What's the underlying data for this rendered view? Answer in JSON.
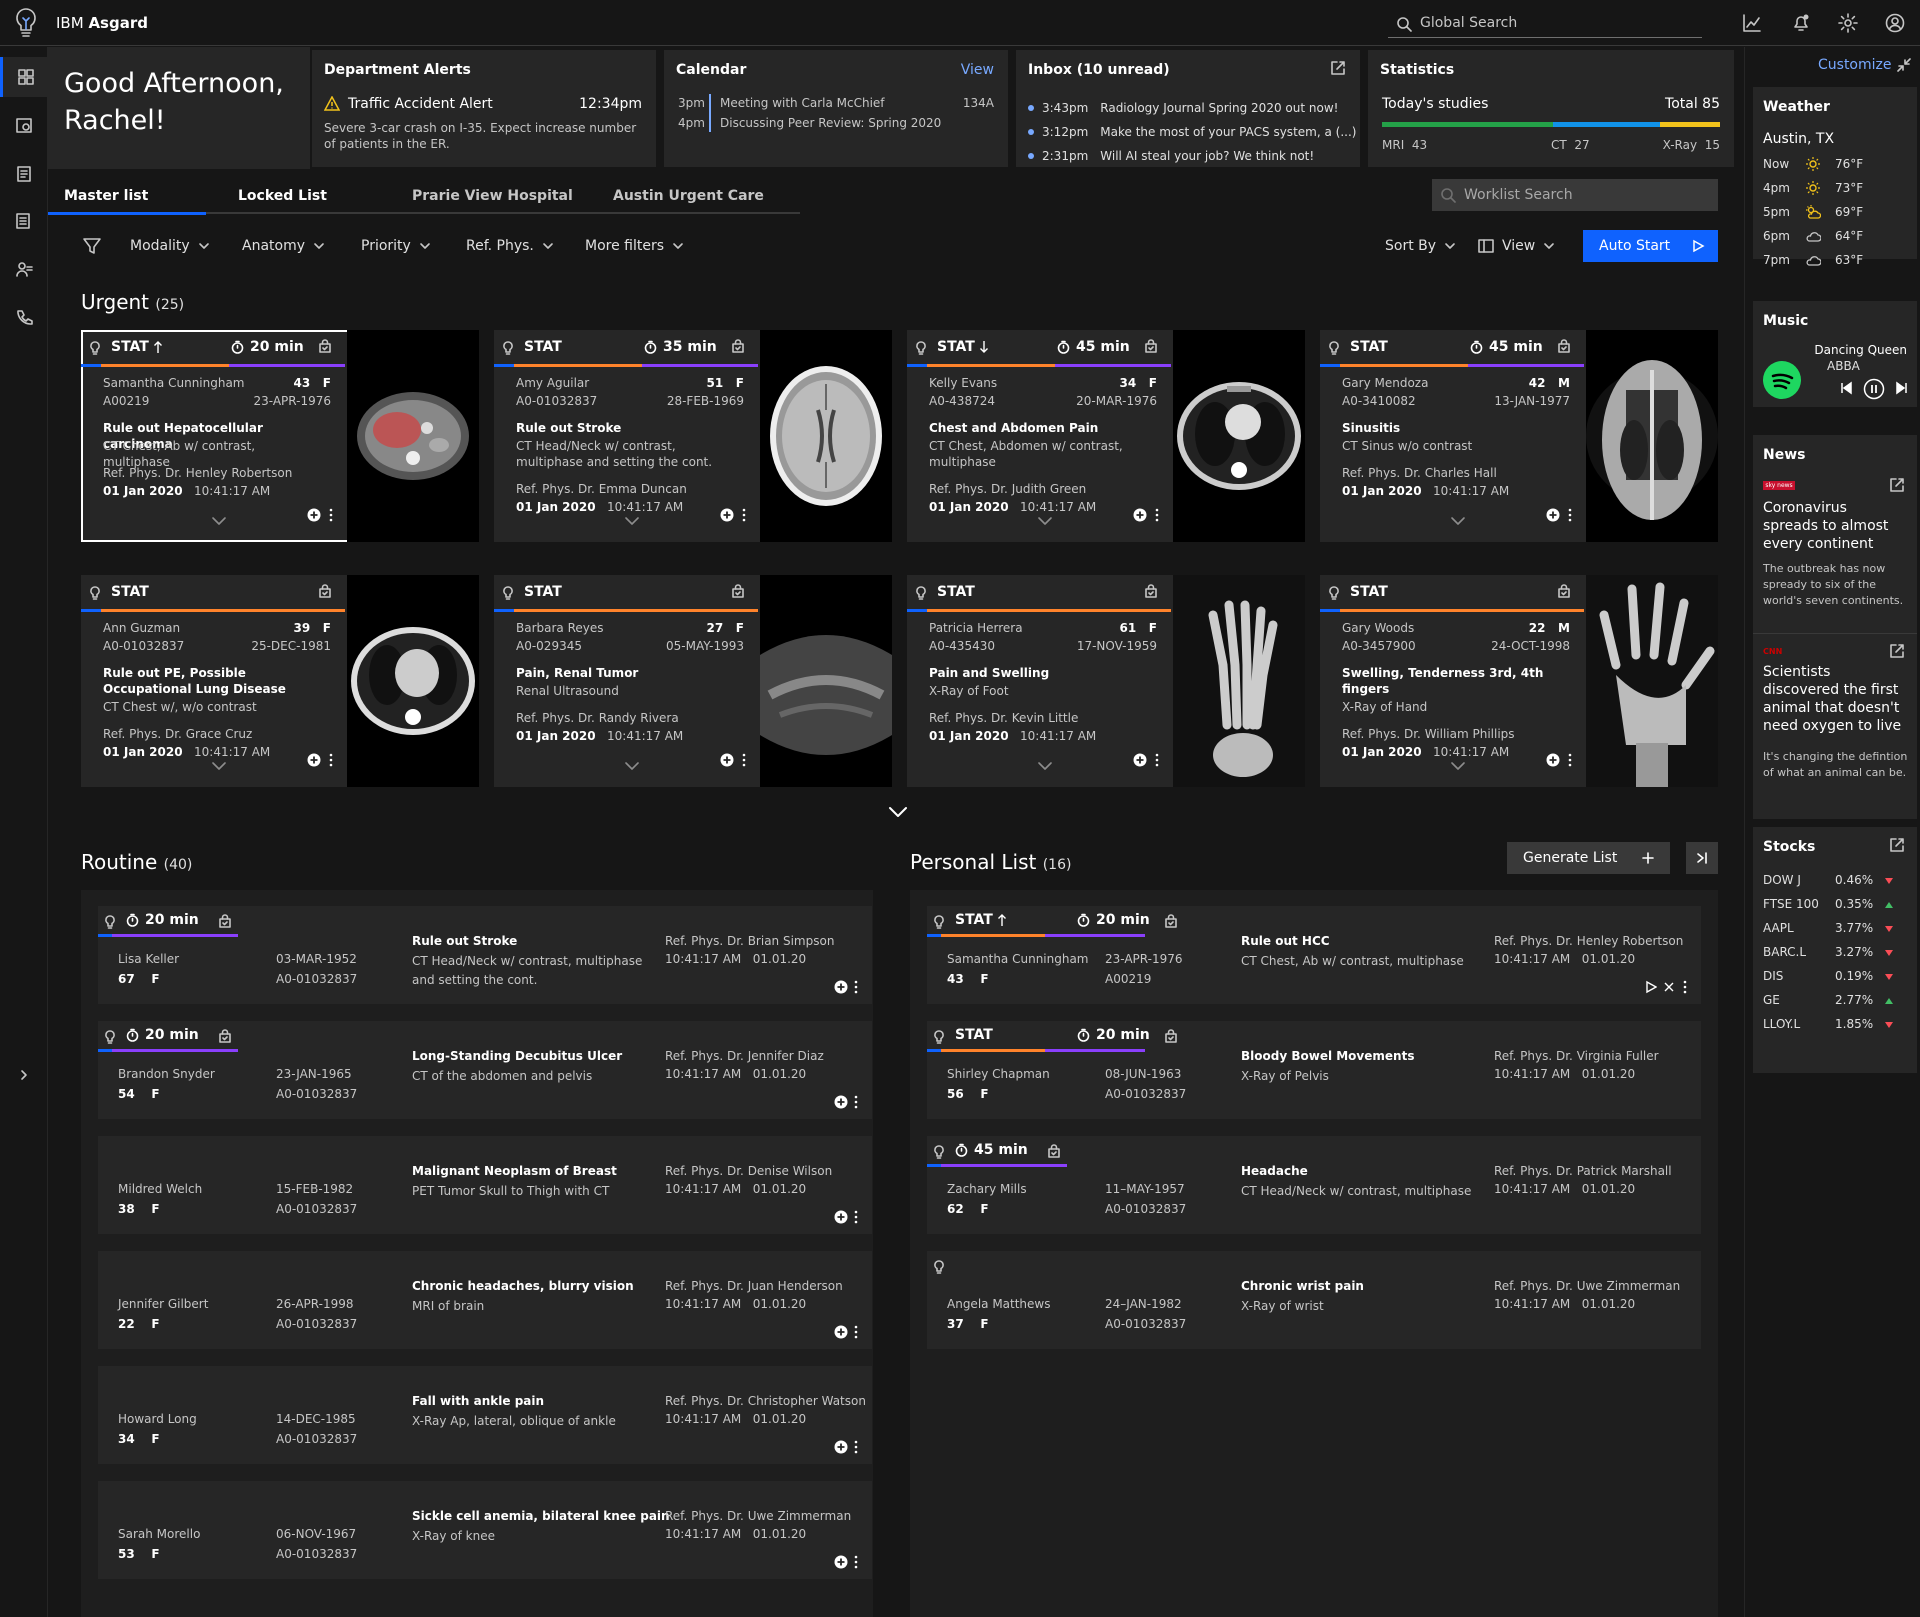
{
  "app": {
    "brand_prefix": "IBM",
    "brand_name": "Asgard"
  },
  "header": {
    "search_placeholder": "Global Search"
  },
  "greeting": {
    "line1": "Good Afternoon,",
    "line2": "Rachel!"
  },
  "alerts": {
    "title": "Department Alerts",
    "item_title": "Traffic Accident Alert",
    "time": "12:34pm",
    "body": "Severe 3-car crash on I-35. Expect increase number of patients in the ER."
  },
  "calendar": {
    "title": "Calendar",
    "view_label": "View",
    "items": [
      {
        "time": "3pm",
        "text": "Meeting with Carla McChief",
        "room": "134A"
      },
      {
        "time": "4pm",
        "text": "Discussing Peer Review: Spring 2020",
        "room": ""
      }
    ]
  },
  "inbox": {
    "title": "Inbox (10 unread)",
    "items": [
      {
        "time": "3:43pm",
        "text": "Radiology Journal Spring 2020 out now!"
      },
      {
        "time": "3:12pm",
        "text": "Make the most of your PACS system, a (...)"
      },
      {
        "time": "2:31pm",
        "text": "Will AI steal your job? We think not!"
      }
    ]
  },
  "statistics": {
    "title": "Statistics",
    "label": "Today's studies",
    "total": "Total 85",
    "mri_label": "MRI",
    "mri": "43",
    "ct_label": "CT",
    "ct": "27",
    "xray_label": "X-Ray",
    "xray": "15",
    "mri_frac": 0.506,
    "ct_frac": 0.318,
    "xray_frac": 0.176,
    "colors": {
      "mri": "#24a148",
      "ct": "#1192e8",
      "xray": "#f1c21b"
    }
  },
  "tabs": [
    {
      "label": "Master list"
    },
    {
      "label": "Locked List"
    },
    {
      "label": "Prarie View Hospital"
    },
    {
      "label": "Austin Urgent Care"
    }
  ],
  "worklist_search_placeholder": "Worklist Search",
  "filters": {
    "items": [
      "Modality",
      "Anatomy",
      "Priority",
      "Ref. Phys.",
      "More filters"
    ],
    "sort_by": "Sort By",
    "view": "View",
    "auto_start": "Auto Start"
  },
  "urgent": {
    "title": "Urgent",
    "count": "(25)",
    "cards": [
      {
        "stat": "STAT",
        "arrow": "up",
        "timer": "20 min",
        "name": "Samantha Cunningham",
        "age": "43",
        "sex": "F",
        "id": "A00219",
        "dob": "23-APR-1976",
        "reason": "Rule out Hepatocellular carcinoma",
        "procedure": "CT Chest, Ab w/ contrast, multiphase",
        "ref": "Ref. Phys. Dr. Henley Robertson",
        "date": "01 Jan 2020",
        "time": "10:41:17 AM"
      },
      {
        "stat": "STAT",
        "arrow": "",
        "timer": "35 min",
        "name": "Amy Aguilar",
        "age": "51",
        "sex": "F",
        "id": "A0-01032837",
        "dob": "28-FEB-1969",
        "reason": "Rule out Stroke",
        "procedure": "CT Head/Neck w/ contrast, multiphase and setting the cont.",
        "ref": "Ref. Phys. Dr. Emma Duncan",
        "date": "01 Jan 2020",
        "time": "10:41:17 AM"
      },
      {
        "stat": "STAT",
        "arrow": "down",
        "timer": "45 min",
        "name": "Kelly Evans",
        "age": "34",
        "sex": "F",
        "id": "A0-438724",
        "dob": "20-MAR-1976",
        "reason": "Chest and Abdomen Pain",
        "procedure": "CT Chest, Abdomen w/ contrast, multiphase",
        "ref": "Ref. Phys. Dr. Judith Green",
        "date": "01 Jan 2020",
        "time": "10:41:17 AM"
      },
      {
        "stat": "STAT",
        "arrow": "",
        "timer": "45 min",
        "name": "Gary Mendoza",
        "age": "42",
        "sex": "M",
        "id": "A0-3410082",
        "dob": "13-JAN-1977",
        "reason": "Sinusitis",
        "procedure": "CT Sinus w/o contrast",
        "ref": "Ref. Phys. Dr. Charles Hall",
        "date": "01 Jan 2020",
        "time": "10:41:17 AM"
      },
      {
        "stat": "STAT",
        "arrow": "",
        "timer": "",
        "name": "Ann Guzman",
        "age": "39",
        "sex": "F",
        "id": "A0-01032837",
        "dob": "25-DEC-1981",
        "reason": "Rule out PE, Possible Occupational Lung Disease",
        "procedure": "CT Chest w/, w/o contrast",
        "ref": "Ref. Phys. Dr. Grace Cruz",
        "date": "01 Jan 2020",
        "time": "10:41:17 AM"
      },
      {
        "stat": "STAT",
        "arrow": "",
        "timer": "",
        "name": "Barbara Reyes",
        "age": "27",
        "sex": "F",
        "id": "A0-029345",
        "dob": "05-MAY-1993",
        "reason": "Pain, Renal Tumor",
        "procedure": "Renal Ultrasound",
        "ref": "Ref. Phys. Dr. Randy Rivera",
        "date": "01 Jan 2020",
        "time": "10:41:17 AM"
      },
      {
        "stat": "STAT",
        "arrow": "",
        "timer": "",
        "name": "Patricia Herrera",
        "age": "61",
        "sex": "F",
        "id": "A0-435430",
        "dob": "17-NOV-1959",
        "reason": "Pain and Swelling",
        "procedure": "X-Ray of Foot",
        "ref": "Ref. Phys. Dr. Kevin Little",
        "date": "01 Jan 2020",
        "time": "10:41:17 AM"
      },
      {
        "stat": "STAT",
        "arrow": "",
        "timer": "",
        "name": "Gary Woods",
        "age": "22",
        "sex": "M",
        "id": "A0-3457900",
        "dob": "24-OCT-1998",
        "reason": "Swelling, Tenderness 3rd, 4th fingers",
        "procedure": "X-Ray of Hand",
        "ref": "Ref. Phys. Dr. William Phillips",
        "date": "01 Jan 2020",
        "time": "10:41:17 AM"
      }
    ]
  },
  "routine": {
    "title": "Routine",
    "count": "(40)",
    "rows": [
      {
        "timer": "20 min",
        "name": "Lisa Keller",
        "age": "67",
        "sex": "F",
        "dob": "03-MAR-1952",
        "id": "A0-01032837",
        "reason": "Rule out Stroke",
        "procedure": "CT Head/Neck w/ contrast, multiphase and setting the cont.",
        "ref": "Ref. Phys. Dr. Brian Simpson",
        "time": "10:41:17 AM",
        "date": "01.01.20"
      },
      {
        "timer": "20 min",
        "name": "Brandon Snyder",
        "age": "54",
        "sex": "F",
        "dob": "23-JAN-1965",
        "id": "A0-01032837",
        "reason": "Long-Standing Decubitus Ulcer",
        "procedure": "CT of the abdomen and pelvis",
        "ref": "Ref. Phys. Dr. Jennifer Diaz",
        "time": "10:41:17 AM",
        "date": "01.01.20"
      },
      {
        "timer": "",
        "name": "Mildred Welch",
        "age": "38",
        "sex": "F",
        "dob": "15-FEB-1982",
        "id": "A0-01032837",
        "reason": "Malignant Neoplasm of Breast",
        "procedure": "PET Tumor Skull to Thigh with CT",
        "ref": "Ref. Phys. Dr. Denise Wilson",
        "time": "10:41:17 AM",
        "date": "01.01.20"
      },
      {
        "timer": "",
        "name": "Jennifer Gilbert",
        "age": "22",
        "sex": "F",
        "dob": "26-APR-1998",
        "id": "A0-01032837",
        "reason": "Chronic headaches, blurry vision",
        "procedure": "MRI of brain",
        "ref": "Ref. Phys. Dr. Juan Henderson",
        "time": "10:41:17 AM",
        "date": "01.01.20"
      },
      {
        "timer": "",
        "name": "Howard Long",
        "age": "34",
        "sex": "F",
        "dob": "14-DEC-1985",
        "id": "A0-01032837",
        "reason": "Fall with ankle pain",
        "procedure": "X-Ray Ap, lateral, oblique of ankle",
        "ref": "Ref. Phys. Dr. Christopher Watson",
        "time": "10:41:17 AM",
        "date": "01.01.20"
      },
      {
        "timer": "",
        "name": "Sarah Morello",
        "age": "53",
        "sex": "F",
        "dob": "06-NOV-1967",
        "id": "A0-01032837",
        "reason": "Sickle cell anemia, bilateral knee pain",
        "procedure": "X-Ray of knee",
        "ref": "Ref. Phys. Dr. Uwe Zimmerman",
        "time": "10:41:17 AM",
        "date": "01.01.20"
      }
    ]
  },
  "personal": {
    "title": "Personal List",
    "count": "(16)",
    "generate_label": "Generate List",
    "rows": [
      {
        "stat": "STAT",
        "timer": "20 min",
        "name": "Samantha Cunningham",
        "age": "43",
        "sex": "F",
        "dob": "23-APR-1976",
        "id": "A00219",
        "reason": "Rule out HCC",
        "procedure": "CT Chest, Ab w/ contrast, multiphase",
        "ref": "Ref. Phys. Dr. Henley Robertson",
        "time": "10:41:17 AM",
        "date": "01.01.20"
      },
      {
        "stat": "STAT",
        "timer": "20 min",
        "name": "Shirley Chapman",
        "age": "56",
        "sex": "F",
        "dob": "08-JUN-1963",
        "id": "A0-01032837",
        "reason": "Bloody Bowel Movements",
        "procedure": "X-Ray of Pelvis",
        "ref": "Ref. Phys. Dr. Virginia Fuller",
        "time": "10:41:17 AM",
        "date": "01.01.20"
      },
      {
        "stat": "",
        "timer": "45 min",
        "name": "Zachary Mills",
        "age": "62",
        "sex": "F",
        "dob": "11–MAY-1957",
        "id": "A0-01032837",
        "reason": "Headache",
        "procedure": "CT Head/Neck w/ contrast, multiphase",
        "ref": "Ref. Phys. Dr. Patrick Marshall",
        "time": "10:41:17 AM",
        "date": "01.01.20"
      },
      {
        "stat": "",
        "timer": "",
        "name": "Angela Matthews",
        "age": "37",
        "sex": "F",
        "dob": "24–JAN-1982",
        "id": "A0-01032837",
        "reason": "Chronic wrist pain",
        "procedure": "X-Ray of wrist",
        "ref": "Ref. Phys. Dr. Uwe Zimmerman",
        "time": "10:41:17 AM",
        "date": "01.01.20"
      }
    ]
  },
  "sidebar": {
    "customize": "Customize",
    "weather": {
      "title": "Weather",
      "city": "Austin, TX",
      "rows": [
        {
          "t": "Now",
          "v": "76°F",
          "icon": "sun-icon"
        },
        {
          "t": "4pm",
          "v": "73°F",
          "icon": "sun-icon"
        },
        {
          "t": "5pm",
          "v": "69°F",
          "icon": "partly-cloudy-icon"
        },
        {
          "t": "6pm",
          "v": "64°F",
          "icon": "cloud-icon"
        },
        {
          "t": "7pm",
          "v": "63°F",
          "icon": "cloud-icon"
        }
      ]
    },
    "music": {
      "title": "Music",
      "song": "Dancing Queen",
      "artist": "ABBA"
    },
    "news": {
      "title": "News",
      "items": [
        {
          "source": "sky news",
          "headline": "Coronavirus spreads to almost every continent",
          "body": "The outbreak has now spready to six of the world's seven continents."
        },
        {
          "source": "CNN",
          "headline": "Scientists discovered the first animal that doesn't need oxygen to live",
          "body": "It's changing the defintion of what an animal can be."
        }
      ]
    },
    "stocks": {
      "title": "Stocks",
      "rows": [
        {
          "n": "DOW J",
          "v": "0.46%",
          "d": "down"
        },
        {
          "n": "FTSE 100",
          "v": "0.35%",
          "d": "up"
        },
        {
          "n": "AAPL",
          "v": "3.77%",
          "d": "down"
        },
        {
          "n": "BARC.L",
          "v": "3.27%",
          "d": "down"
        },
        {
          "n": "DIS",
          "v": "0.19%",
          "d": "down"
        },
        {
          "n": "GE",
          "v": "2.77%",
          "d": "up"
        },
        {
          "n": "LLOY.L",
          "v": "1.85%",
          "d": "down"
        }
      ]
    }
  }
}
